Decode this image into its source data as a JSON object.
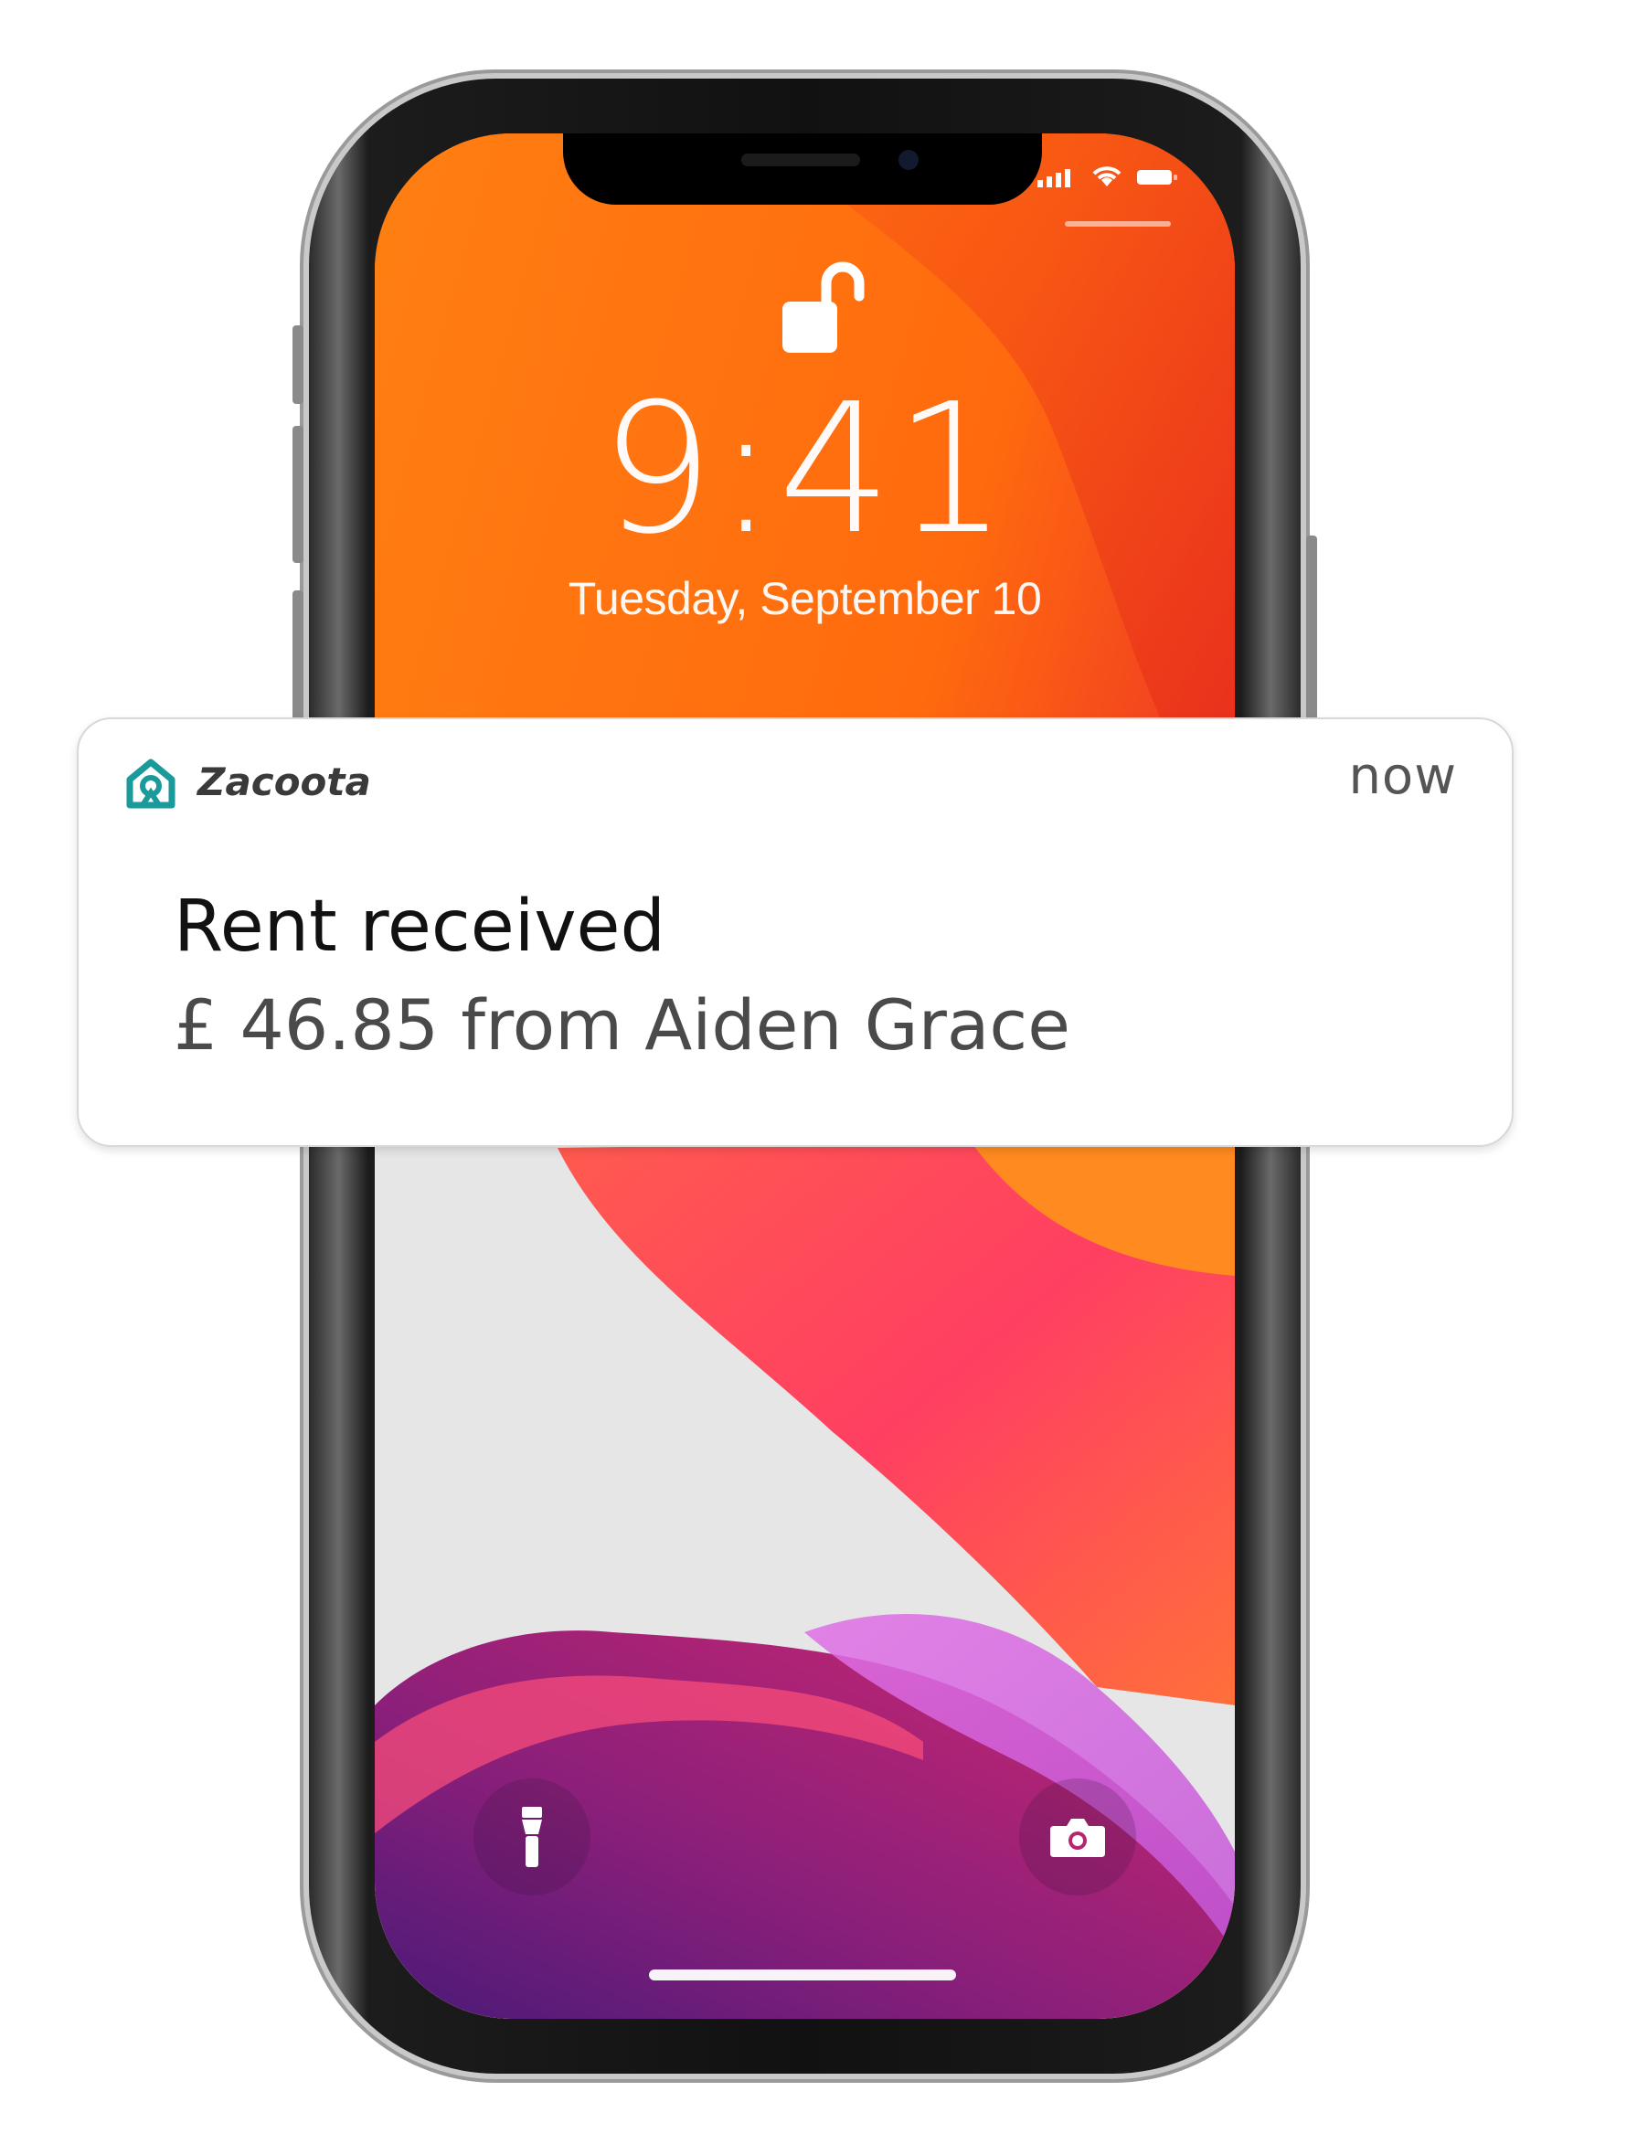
{
  "lockscreen": {
    "time": "9:41",
    "date": "Tuesday, September 10"
  },
  "status_bar": {
    "icons": [
      "signal-icon",
      "wifi-icon",
      "battery-icon"
    ]
  },
  "quick_actions": {
    "left_icon": "flashlight-icon",
    "right_icon": "camera-icon"
  },
  "notification": {
    "app_name": "Zacoota",
    "timestamp": "now",
    "title": "Rent received",
    "body": "£ 46.85 from Aiden Grace",
    "app_icon": "house-icon",
    "accent_color": "#1a9a9a"
  },
  "colors": {
    "wallpaper_orange": "#ff7a10",
    "wallpaper_red": "#e8232f",
    "wallpaper_pink": "#ff4f7a",
    "wallpaper_purple": "#8a1f7a",
    "wallpaper_violet": "#d670e0",
    "wallpaper_grey": "#e6e6e6"
  }
}
